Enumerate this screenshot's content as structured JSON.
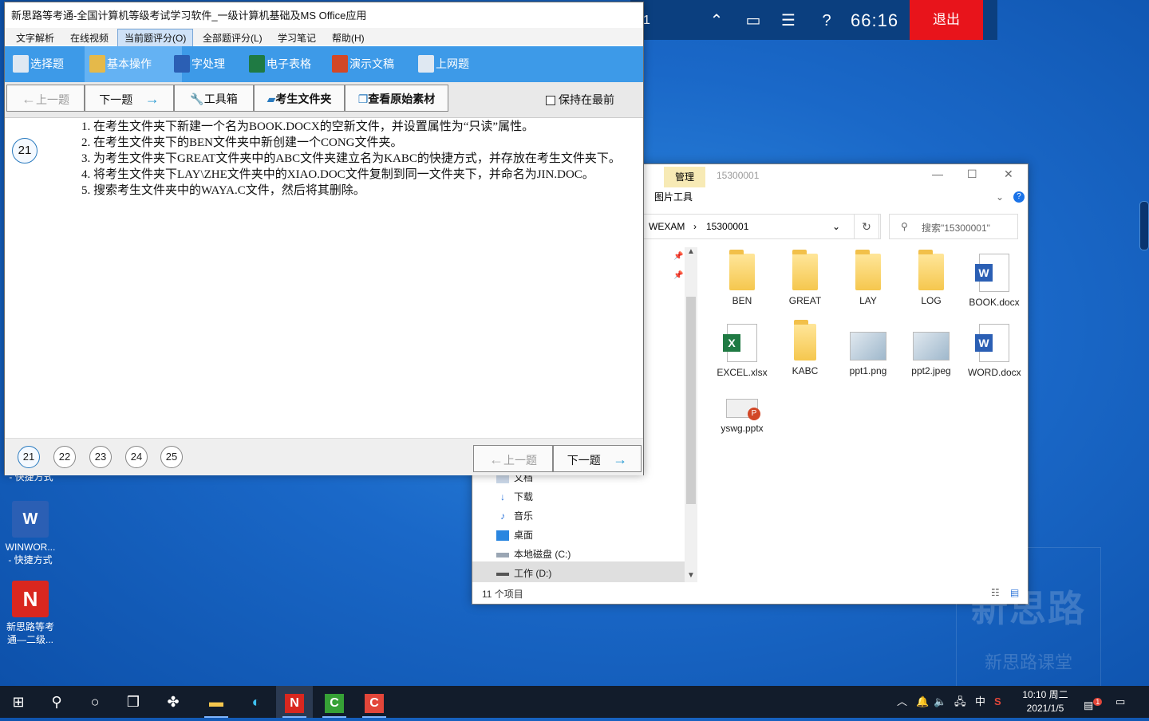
{
  "exam_bar": {
    "left_num": "1",
    "timer": "66:16",
    "exit_label": "退出",
    "icons": [
      "collapse-icon",
      "window-icon",
      "checklist-icon",
      "help-icon"
    ]
  },
  "app": {
    "title": "新思路等考通-全国计算机等级考试学习软件_一级计算机基础及MS Office应用",
    "menu": [
      "文字解析",
      "在线视频",
      "当前题评分(O)",
      "全部题评分(L)",
      "学习笔记",
      "帮助(H)"
    ],
    "toolbar": [
      "选择题",
      "基本操作",
      "字处理",
      "电子表格",
      "演示文稿",
      "上网题"
    ],
    "nav": {
      "prev": "上一题",
      "next": "下一题",
      "toolbox": "工具箱",
      "student_folder": "考生文件夹",
      "original": "查看原始素材",
      "keep_front": "保持在最前"
    },
    "question_number": "21",
    "question_lines": [
      "1.  在考生文件夹下新建一个名为BOOK.DOCX的空新文件，并设置属性为“只读”属性。",
      "2.  在考生文件夹下的BEN文件夹中新创建一个CONG文件夹。",
      "3.  为考生文件夹下GREAT文件夹中的ABC文件夹建立名为KABC的快捷方式，并存放在考生文件夹下。",
      "4.  将考生文件夹下LAY\\ZHE文件夹中的XIAO.DOC文件复制到同一文件夹下，并命名为JIN.DOC。",
      "5.  搜索考生文件夹中的WAYA.C文件，然后将其删除。"
    ],
    "bottom": {
      "questions": [
        "21",
        "22",
        "23",
        "24",
        "25"
      ],
      "prev": "上一题",
      "next": "下一题"
    }
  },
  "explorer": {
    "ribbon_tab": "管理",
    "ribbon_group": "图片工具",
    "window_title": "15300001",
    "path": [
      "WEXAM",
      "15300001"
    ],
    "search_placeholder": "搜索\"15300001\"",
    "files": [
      {
        "name": "BEN",
        "type": "folder"
      },
      {
        "name": "GREAT",
        "type": "folder"
      },
      {
        "name": "LAY",
        "type": "folder"
      },
      {
        "name": "LOG",
        "type": "folder"
      },
      {
        "name": "BOOK.docx",
        "type": "word"
      },
      {
        "name": "EXCEL.xlsx",
        "type": "excel"
      },
      {
        "name": "KABC",
        "type": "shortcut-folder"
      },
      {
        "name": "ppt1.png",
        "type": "image"
      },
      {
        "name": "ppt2.jpeg",
        "type": "image"
      },
      {
        "name": "WORD.docx",
        "type": "word"
      },
      {
        "name": "yswg.pptx",
        "type": "ppt"
      }
    ],
    "nav_items": [
      "文档",
      "下载",
      "音乐",
      "桌面",
      "本地磁盘 (C:)",
      "工作 (D:)"
    ],
    "status": "11 个项目"
  },
  "desktop": {
    "icons": [
      {
        "label1": "- 快捷方式",
        "label2": ""
      },
      {
        "label1": "WINWOR...",
        "label2": "- 快捷方式"
      },
      {
        "label1": "新思路等考",
        "label2": "通—二级..."
      }
    ]
  },
  "taskbar": {
    "time": "10:10 周二",
    "date": "2021/1/5",
    "ime": "中",
    "notif_count": "1"
  },
  "watermark": {
    "big": "新思路",
    "small": "新思路课堂"
  }
}
